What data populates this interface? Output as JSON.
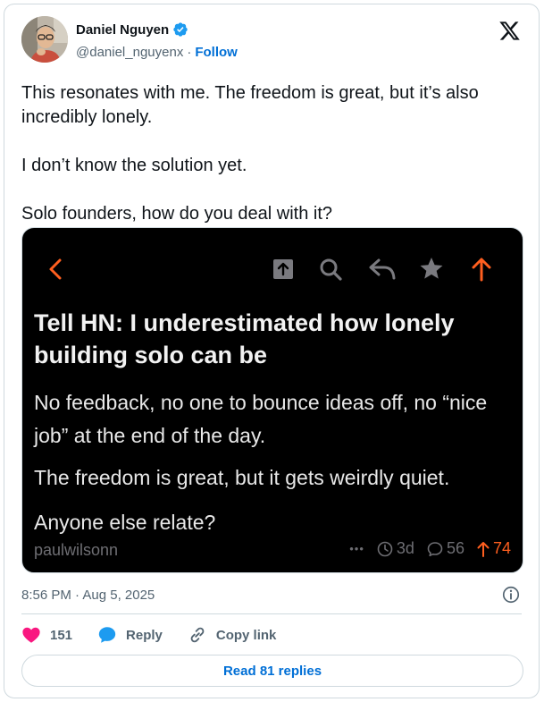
{
  "author": {
    "name": "Daniel Nguyen",
    "handle": "@daniel_nguyenx",
    "separator": "·",
    "follow_label": "Follow"
  },
  "tweet": {
    "paragraphs": [
      "This resonates with me. The freedom is great, but it’s also incredibly lonely.",
      "I don’t know the solution yet.",
      "Solo founders, how do you deal with it?"
    ],
    "timestamp": "8:56 PM · Aug 5, 2025"
  },
  "embed": {
    "title": "Tell HN: I underestimated how lonely building solo can be",
    "body": [
      "No feedback, no one to bounce ideas off, no “nice job” at the end of the day.",
      "The freedom is great, but it gets weirdly quiet.",
      "Anyone else relate?"
    ],
    "author": "paulwilsonn",
    "more": "•••",
    "age": "3d",
    "comments": "56",
    "points": "74",
    "accent_color": "#ff5f1f"
  },
  "actions": {
    "likes": "151",
    "reply_label": "Reply",
    "copy_label": "Copy link",
    "read_replies_label": "Read 81 replies"
  },
  "colors": {
    "link_blue": "#006fd6",
    "heart_pink": "#f91880",
    "verified_blue": "#1d9bf0",
    "muted_text": "#536471"
  }
}
